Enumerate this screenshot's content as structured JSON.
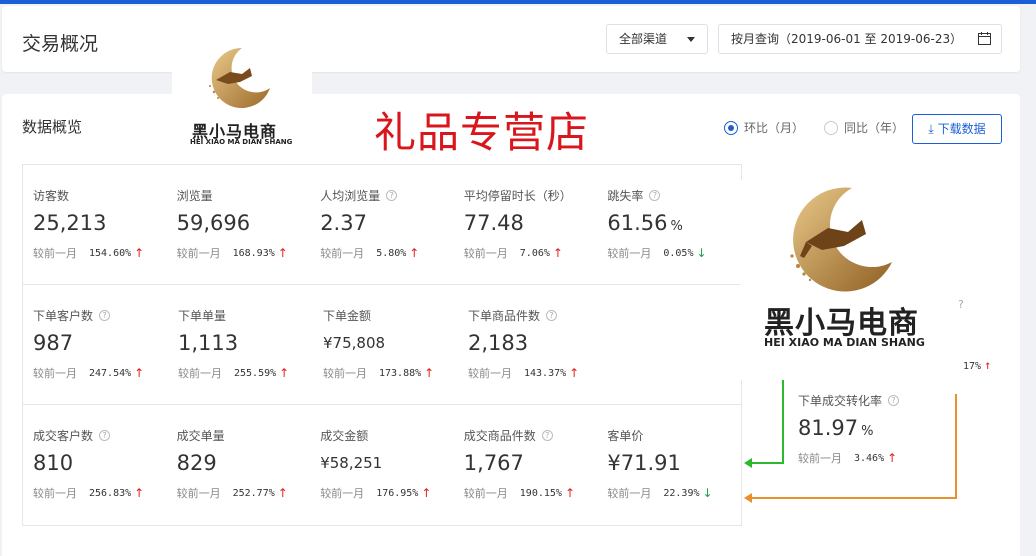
{
  "header": {
    "title": "交易概况",
    "channel": "全部渠道",
    "date_range": "按月查询（2019-06-01 至 2019-06-23）"
  },
  "overview": {
    "title": "数据概览",
    "shop_name": "礼品专营店",
    "radio_mom": "环比（月）",
    "radio_yoy": "同比（年）",
    "download": "下载数据"
  },
  "compare_label": "较前一月",
  "row1": [
    {
      "label": "访客数",
      "help": false,
      "value": "25,213",
      "unit": "",
      "pct": "154.60%",
      "trend": "up"
    },
    {
      "label": "浏览量",
      "help": false,
      "value": "59,696",
      "unit": "",
      "pct": "168.93%",
      "trend": "up"
    },
    {
      "label": "人均浏览量",
      "help": true,
      "value": "2.37",
      "unit": "",
      "pct": "5.80%",
      "trend": "up"
    },
    {
      "label": "平均停留时长（秒）",
      "help": false,
      "value": "77.48",
      "unit": "",
      "pct": "7.06%",
      "trend": "up"
    },
    {
      "label": "跳失率",
      "help": true,
      "value": "61.56",
      "unit": "%",
      "pct": "0.05%",
      "trend": "down"
    }
  ],
  "row2": [
    {
      "label": "下单客户数",
      "help": true,
      "value": "987",
      "unit": "",
      "pct": "247.54%",
      "trend": "up"
    },
    {
      "label": "下单单量",
      "help": false,
      "value": "1,113",
      "unit": "",
      "pct": "255.59%",
      "trend": "up"
    },
    {
      "label": "下单金额",
      "help": false,
      "value": "¥75,808",
      "unit": "",
      "pct": "173.88%",
      "trend": "up"
    },
    {
      "label": "下单商品件数",
      "help": true,
      "value": "2,183",
      "unit": "",
      "pct": "143.37%",
      "trend": "up"
    }
  ],
  "row3": [
    {
      "label": "成交客户数",
      "help": true,
      "value": "810",
      "unit": "",
      "pct": "256.83%",
      "trend": "up"
    },
    {
      "label": "成交单量",
      "help": false,
      "value": "829",
      "unit": "",
      "pct": "252.77%",
      "trend": "up"
    },
    {
      "label": "成交金额",
      "help": false,
      "value": "¥58,251",
      "unit": "",
      "pct": "176.95%",
      "trend": "up"
    },
    {
      "label": "成交商品件数",
      "help": true,
      "value": "1,767",
      "unit": "",
      "pct": "190.15%",
      "trend": "up"
    },
    {
      "label": "客单价",
      "help": false,
      "value": "¥71.91",
      "unit": "",
      "pct": "22.39%",
      "trend": "down"
    }
  ],
  "side": {
    "label": "下单成交转化率",
    "value": "81.97",
    "unit": "%",
    "pct": "3.46%",
    "edge_pct": "17%"
  },
  "logo": {
    "cn": "黑小马电商",
    "en": "HEI XIAO MA DIAN SHANG"
  },
  "colors": {
    "accent": "#1a5fd6",
    "shop_red": "#d8161c",
    "up": "#e02020",
    "down": "#1aa34a",
    "flow_green": "#2eb82e",
    "flow_orange": "#e8902a",
    "gold": "#b8873a"
  }
}
